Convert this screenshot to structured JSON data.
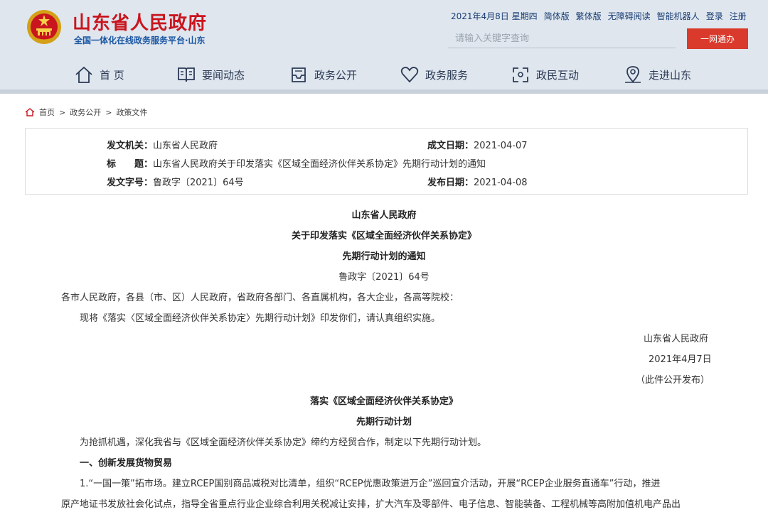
{
  "header": {
    "site_title": "山东省人民政府",
    "site_subtitle": "全国一体化在线政务服务平台·山东",
    "date": "2021年4月8日 星期四",
    "links": [
      "简体版",
      "繁体版",
      "无障碍阅读",
      "智能机器人",
      "登录",
      "注册"
    ],
    "search_placeholder": "请输入关键字查询",
    "onestop_label": "一网通办"
  },
  "nav": {
    "items": [
      {
        "label": "首 页",
        "icon": "home-icon"
      },
      {
        "label": "要闻动态",
        "icon": "book-icon"
      },
      {
        "label": "政务公开",
        "icon": "inbox-icon"
      },
      {
        "label": "政务服务",
        "icon": "heart-icon"
      },
      {
        "label": "政民互动",
        "icon": "interaction-icon"
      },
      {
        "label": "走进山东",
        "icon": "location-icon"
      }
    ]
  },
  "breadcrumb": [
    "首页",
    "政务公开",
    "政策文件"
  ],
  "info": {
    "issuer_label": "发文机关：",
    "issuer": "山东省人民政府",
    "date_written_label": "成文日期：",
    "date_written": "2021-04-07",
    "title_label": "标　　题：",
    "title": "山东省人民政府关于印发落实《区域全面经济伙伴关系协定》先期行动计划的通知",
    "doc_no_label": "发文字号：",
    "doc_no": "鲁政字〔2021〕64号",
    "publish_date_label": "发布日期：",
    "publish_date": "2021-04-08"
  },
  "document": {
    "heading1": "山东省人民政府",
    "heading2": "关于印发落实《区域全面经济伙伴关系协定》",
    "heading3": "先期行动计划的通知",
    "doc_no": "鲁政字〔2021〕64号",
    "recipients": "各市人民政府，各县（市、区）人民政府，省政府各部门、各直属机构，各大企业，各高等院校：",
    "body1": "现将《落实〈区域全面经济伙伴关系协定〉先期行动计划》印发你们，请认真组织实施。",
    "sign_org": "山东省人民政府",
    "sign_date": "2021年4月7日",
    "sign_note": "（此件公开发布）",
    "plan_title1": "落实《区域全面经济伙伴关系协定》",
    "plan_title2": "先期行动计划",
    "intro": "为抢抓机遇，深化我省与《区域全面经济伙伴关系协定》缔约方经贸合作，制定以下先期行动计划。",
    "section1": "一、创新发展货物贸易",
    "item1_line1": "1.“一国一策”拓市场。建立RCEP国别商品减税对比清单，组织“RCEP优惠政策进万企”巡回宣介活动，开展“RCEP企业服务直通车”行动，推进",
    "item1_line2": "原产地证书发放社会化试点，指导全省重点行业企业综合利用关税减让安排，扩大汽车及零部件、电子信息、智能装备、工程机械等高附加值机电产品出"
  },
  "colors": {
    "brand_red": "#c9151e",
    "header_bg": "#dfe6ee",
    "button_red": "#d93a2c",
    "link_blue": "#1a3e74"
  }
}
